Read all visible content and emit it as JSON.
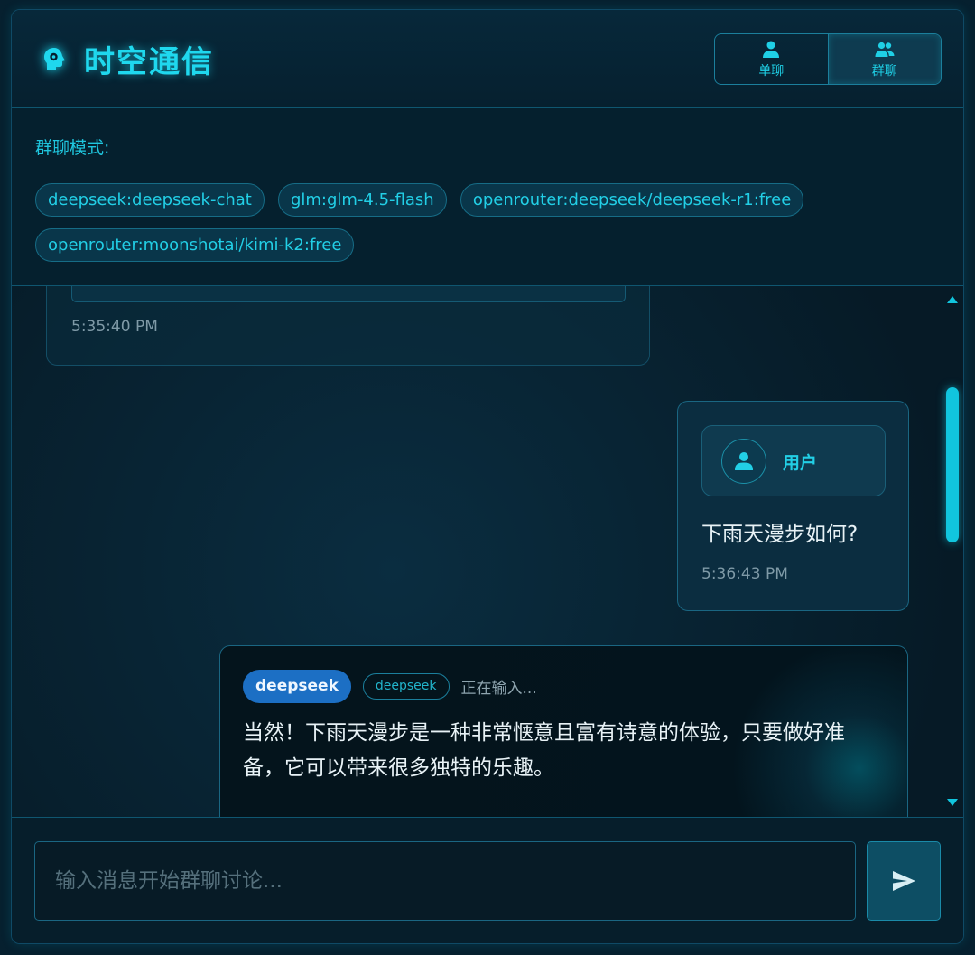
{
  "header": {
    "title": "时空通信",
    "brand_icon": "brain-head-icon",
    "modes": [
      {
        "label": "单聊",
        "icon": "user-icon",
        "active": false
      },
      {
        "label": "群聊",
        "icon": "users-icon",
        "active": true
      }
    ]
  },
  "group": {
    "label": "群聊模式:",
    "models": [
      "deepseek:deepseek-chat",
      "glm:glm-4.5-flash",
      "openrouter:deepseek/deepseek-r1:free",
      "openrouter:moonshotai/kimi-k2:free"
    ]
  },
  "messages": {
    "previous": {
      "time": "5:35:40 PM"
    },
    "user": {
      "name": "用户",
      "text": "下雨天漫步如何?",
      "time": "5:36:43 PM"
    },
    "ai": {
      "badge": "deepseek",
      "tag": "deepseek",
      "status": "正在输入...",
      "text": "当然！下雨天漫步是一种非常惬意且富有诗意的体验，只要做好准备，它可以带来很多独特的乐趣。"
    }
  },
  "input": {
    "placeholder": "输入消息开始群聊讨论..."
  },
  "colors": {
    "accent": "#1fd8ee",
    "badge": "#1c6fc4",
    "background": "#06202f"
  }
}
